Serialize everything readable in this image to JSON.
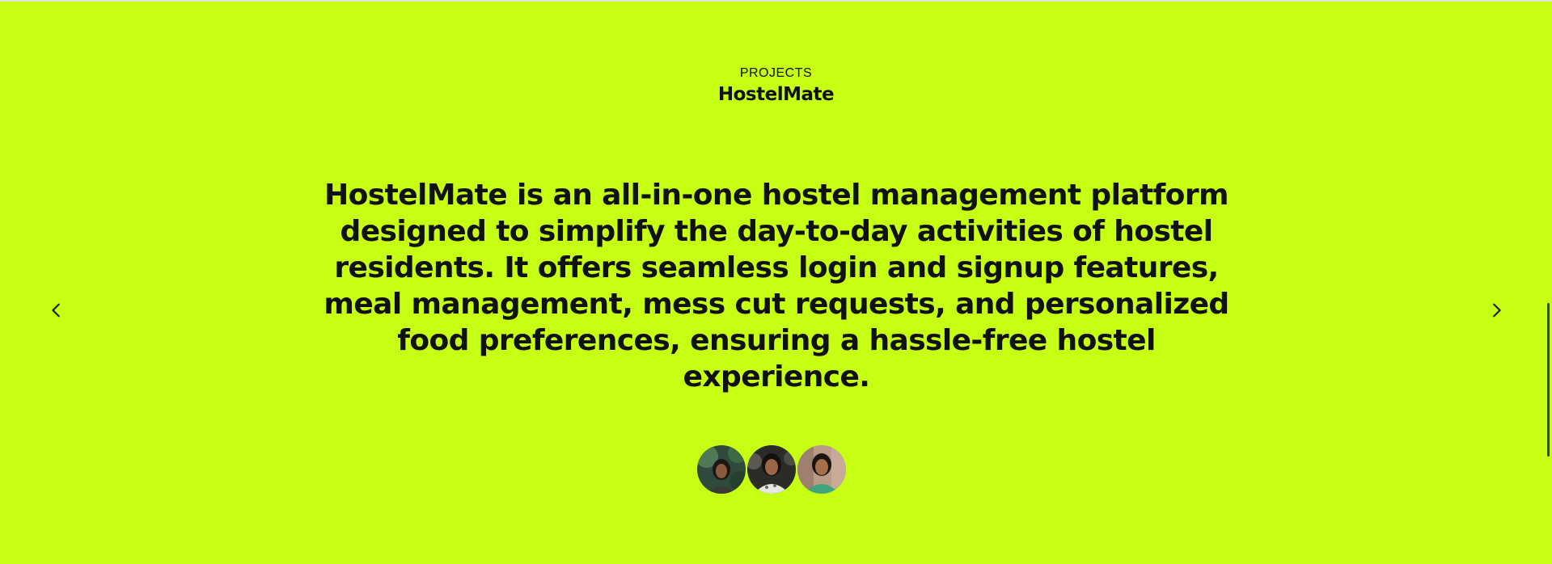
{
  "section": {
    "eyebrow": "PROJECTS",
    "title": "HostelMate",
    "description": "HostelMate is an all-in-one hostel management platform designed to simplify the day-to-day activities of hostel residents. It offers seamless login and signup features, meal management, mess cut requests, and personalized food preferences, ensuring a hassle-free hostel experience."
  },
  "navigation": {
    "prev_icon": "chevron-left-icon",
    "next_icon": "chevron-right-icon"
  },
  "colors": {
    "background": "#c6ff14",
    "text": "#111111"
  }
}
